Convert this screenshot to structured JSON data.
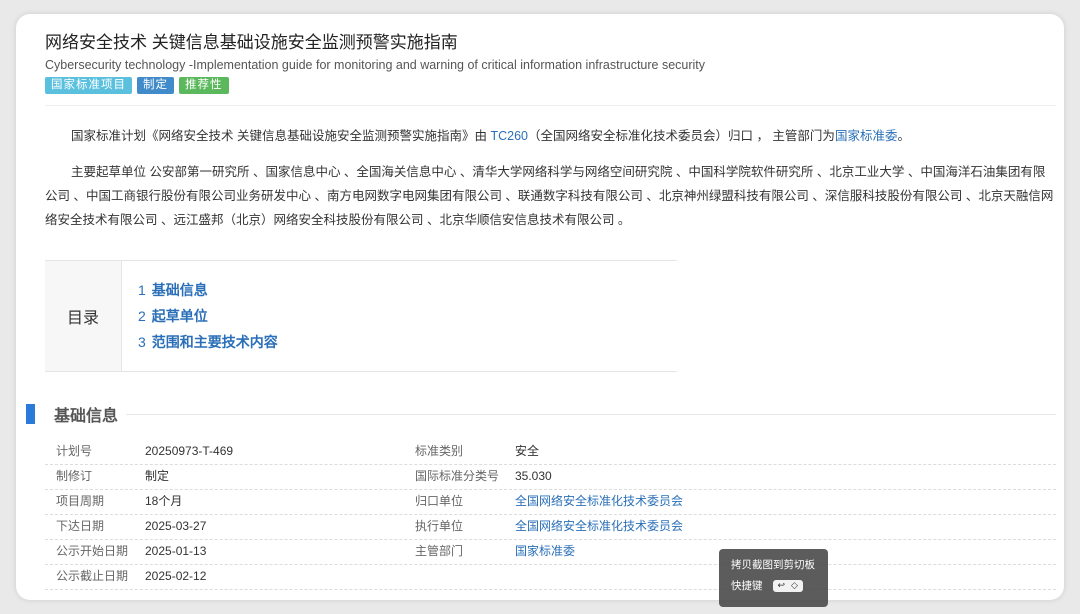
{
  "header": {
    "title": "网络安全技术 关键信息基础设施安全监测预警实施指南",
    "subtitle": "Cybersecurity technology -Implementation guide for monitoring and warning of critical information infrastructure security",
    "tags": [
      "国家标准项目",
      "制定",
      "推荐性"
    ]
  },
  "intro": {
    "p1_prefix": "国家标准计划《网络安全技术 关键信息基础设施安全监测预警实施指南》由 ",
    "p1_link1": "TC260",
    "p1_middle": "（全国网络安全标准化技术委员会）归口 ， 主管部门为",
    "p1_link2": "国家标准委",
    "p1_suffix": "。",
    "p2": "主要起草单位 公安部第一研究所 、国家信息中心 、全国海关信息中心 、清华大学网络科学与网络空间研究院 、中国科学院软件研究所 、北京工业大学 、中国海洋石油集团有限公司 、中国工商银行股份有限公司业务研发中心 、南方电网数字电网集团有限公司 、联通数字科技有限公司 、北京神州绿盟科技有限公司 、深信服科技股份有限公司 、北京天融信网络安全技术有限公司 、远江盛邦（北京）网络安全科技股份有限公司 、北京华顺信安信息技术有限公司 。"
  },
  "toc": {
    "title": "目录",
    "items": [
      {
        "num": "1",
        "label": "基础信息"
      },
      {
        "num": "2",
        "label": "起草单位"
      },
      {
        "num": "3",
        "label": "范围和主要技术内容"
      }
    ]
  },
  "section": {
    "title": "基础信息"
  },
  "info": [
    {
      "l1": "计划号",
      "v1": "20250973-T-469",
      "l2": "标准类别",
      "v2": "安全"
    },
    {
      "l1": "制修订",
      "v1": "制定",
      "l2": "国际标准分类号",
      "v2": "35.030"
    },
    {
      "l1": "项目周期",
      "v1": "18个月",
      "l2": "归口单位",
      "v2": "全国网络安全标准化技术委员会"
    },
    {
      "l1": "下达日期",
      "v1": "2025-03-27",
      "l2": "执行单位",
      "v2": "全国网络安全标准化技术委员会"
    },
    {
      "l1": "公示开始日期",
      "v1": "2025-01-13",
      "l2": "主管部门",
      "v2": "国家标准委"
    },
    {
      "l1": "公示截止日期",
      "v1": "2025-02-12",
      "l2": "",
      "v2": ""
    }
  ],
  "toast": {
    "line1": "拷贝截图到剪切板",
    "line2": "快捷键",
    "key": "↩",
    "key2": "◇"
  },
  "colors": {
    "accent": "#2a7bd9",
    "link": "#2a6fb8",
    "tag_blue_light": "#5bc0de",
    "tag_blue": "#428bca",
    "tag_green": "#5cb85c"
  }
}
